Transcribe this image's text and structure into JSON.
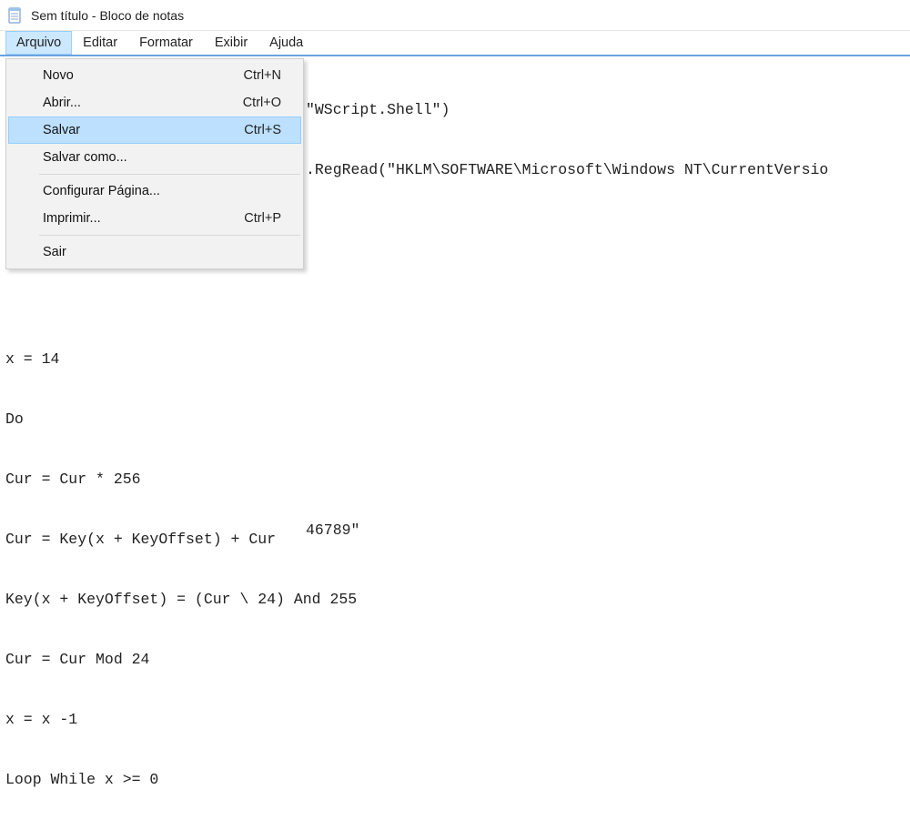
{
  "window": {
    "title": "Sem título - Bloco de notas"
  },
  "menubar": {
    "items": [
      {
        "label": "Arquivo",
        "active": true
      },
      {
        "label": "Editar"
      },
      {
        "label": "Formatar"
      },
      {
        "label": "Exibir"
      },
      {
        "label": "Ajuda"
      }
    ]
  },
  "dropdown": {
    "items": [
      {
        "label": "Novo",
        "shortcut": "Ctrl+N"
      },
      {
        "label": "Abrir...",
        "shortcut": "Ctrl+O"
      },
      {
        "label": "Salvar",
        "shortcut": "Ctrl+S",
        "highlight": true
      },
      {
        "label": "Salvar como..."
      },
      {
        "sep": true
      },
      {
        "label": "Configurar Página..."
      },
      {
        "label": "Imprimir...",
        "shortcut": "Ctrl+P"
      },
      {
        "sep": true
      },
      {
        "label": "Sair"
      }
    ]
  },
  "editor": {
    "lines_top": [
      "\"WScript.Shell\")",
      ".RegRead(\"HKLM\\SOFTWARE\\Microsoft\\Windows NT\\CurrentVersio",
      "",
      "",
      "",
      "",
      "",
      "46789\""
    ],
    "lines_bottom": [
      "x = 14",
      "Do",
      "Cur = Cur * 256",
      "Cur = Key(x + KeyOffset) + Cur",
      "Key(x + KeyOffset) = (Cur \\ 24) And 255",
      "Cur = Cur Mod 24",
      "x = x -1",
      "Loop While x >= 0"
    ]
  }
}
